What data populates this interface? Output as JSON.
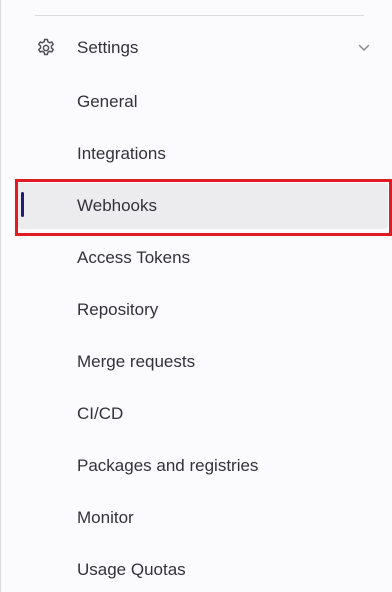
{
  "section": {
    "label": "Settings",
    "icon": "gear-icon",
    "expand_icon": "chevron-down-icon"
  },
  "nav_items": [
    {
      "label": "General",
      "active": false
    },
    {
      "label": "Integrations",
      "active": false
    },
    {
      "label": "Webhooks",
      "active": true
    },
    {
      "label": "Access Tokens",
      "active": false
    },
    {
      "label": "Repository",
      "active": false
    },
    {
      "label": "Merge requests",
      "active": false
    },
    {
      "label": "CI/CD",
      "active": false
    },
    {
      "label": "Packages and registries",
      "active": false
    },
    {
      "label": "Monitor",
      "active": false
    },
    {
      "label": "Usage Quotas",
      "active": false
    }
  ],
  "colors": {
    "active_indicator": "#1f1e6e",
    "highlight_outline": "#e01b24",
    "active_background": "#ececef",
    "text": "#333238"
  }
}
